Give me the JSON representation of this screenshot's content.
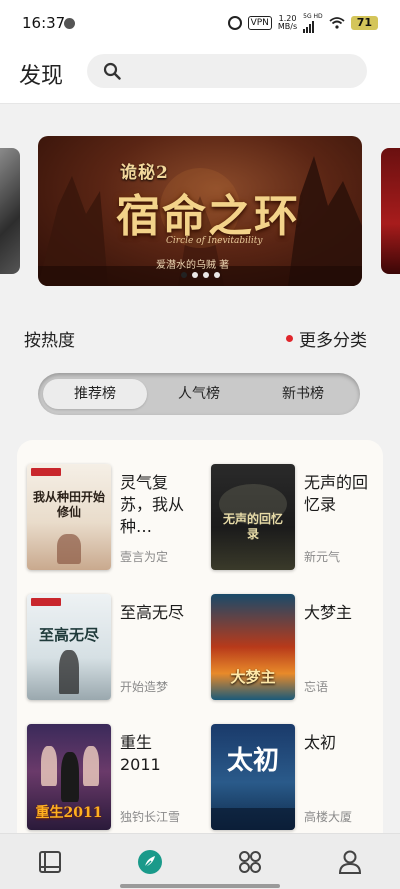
{
  "status": {
    "time": "16:37",
    "vpn": "VPN",
    "net_speed": "1.20",
    "net_unit": "MB/s",
    "net_type": "5G HD",
    "battery": "71"
  },
  "header": {
    "title": "发现",
    "search_placeholder": ""
  },
  "carousel": {
    "banner": {
      "series": "诡秘2",
      "title": "宿命之环",
      "subtitle_en": "Circle of Inevitability",
      "author": "爱潜水的乌贼 著"
    },
    "dots": 4,
    "active_index": 0
  },
  "section": {
    "title": "按热度",
    "more_label": "更多分类",
    "more_dot_color": "#e0262c"
  },
  "tabs": [
    {
      "label": "推荐榜",
      "active": true
    },
    {
      "label": "人气榜",
      "active": false
    },
    {
      "label": "新书榜",
      "active": false
    }
  ],
  "books": [
    {
      "title": "灵气复苏，我从种…",
      "author": "壹言为定",
      "cover_text": "我从种田开始修仙"
    },
    {
      "title": "无声的回忆录",
      "author": "新元气",
      "cover_text": "无声的回忆录"
    },
    {
      "title": "至高无尽",
      "author": "开始造梦",
      "cover_text": "至高无尽"
    },
    {
      "title": "大梦主",
      "author": "忘语",
      "cover_text": "大梦主"
    },
    {
      "title": "重生2011",
      "author": "独钓长江雪",
      "cover_text": "重生2011"
    },
    {
      "title": "太初",
      "author": "高楼大厦",
      "cover_text": "太初"
    }
  ],
  "bottom_nav": [
    {
      "name": "bookshelf",
      "active": false
    },
    {
      "name": "discover",
      "active": true
    },
    {
      "name": "categories",
      "active": false
    },
    {
      "name": "profile",
      "active": false
    }
  ],
  "colors": {
    "accent": "#1a9a8a",
    "banner_gold": "#f3d38a"
  }
}
